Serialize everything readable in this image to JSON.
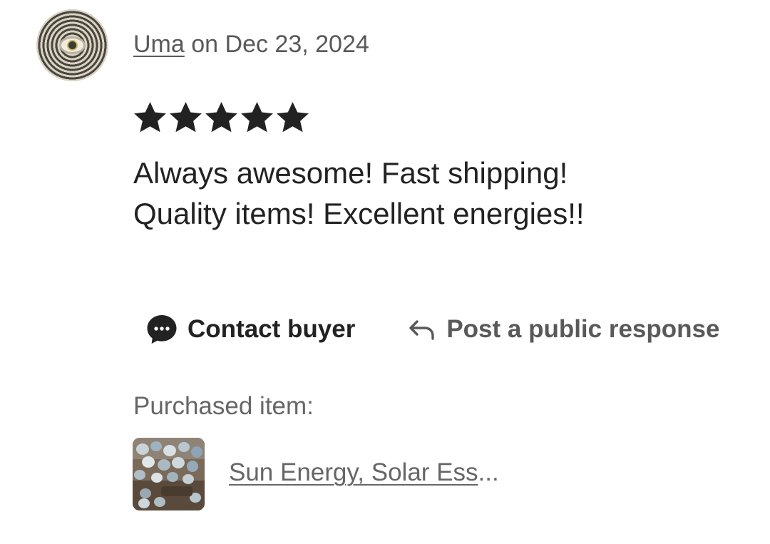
{
  "review": {
    "reviewer_name": "Uma",
    "date_text": "on Dec 23, 2024",
    "rating": 5,
    "rating_max": 5,
    "text_lines": [
      "Always awesome! Fast shipping!",
      "Quality items! Excellent energies!!"
    ]
  },
  "actions": {
    "contact_label": "Contact buyer",
    "respond_label": "Post a public response",
    "contact_icon": "chat-bubble-icon",
    "respond_icon": "reply-arrow-icon"
  },
  "purchase": {
    "label": "Purchased item:",
    "item_title": "Sun Energy, Solar Ess",
    "ellipsis": "..."
  },
  "colors": {
    "primary_text": "#222222",
    "secondary_text": "#595959",
    "muted_text": "#666666",
    "star": "#222222"
  }
}
